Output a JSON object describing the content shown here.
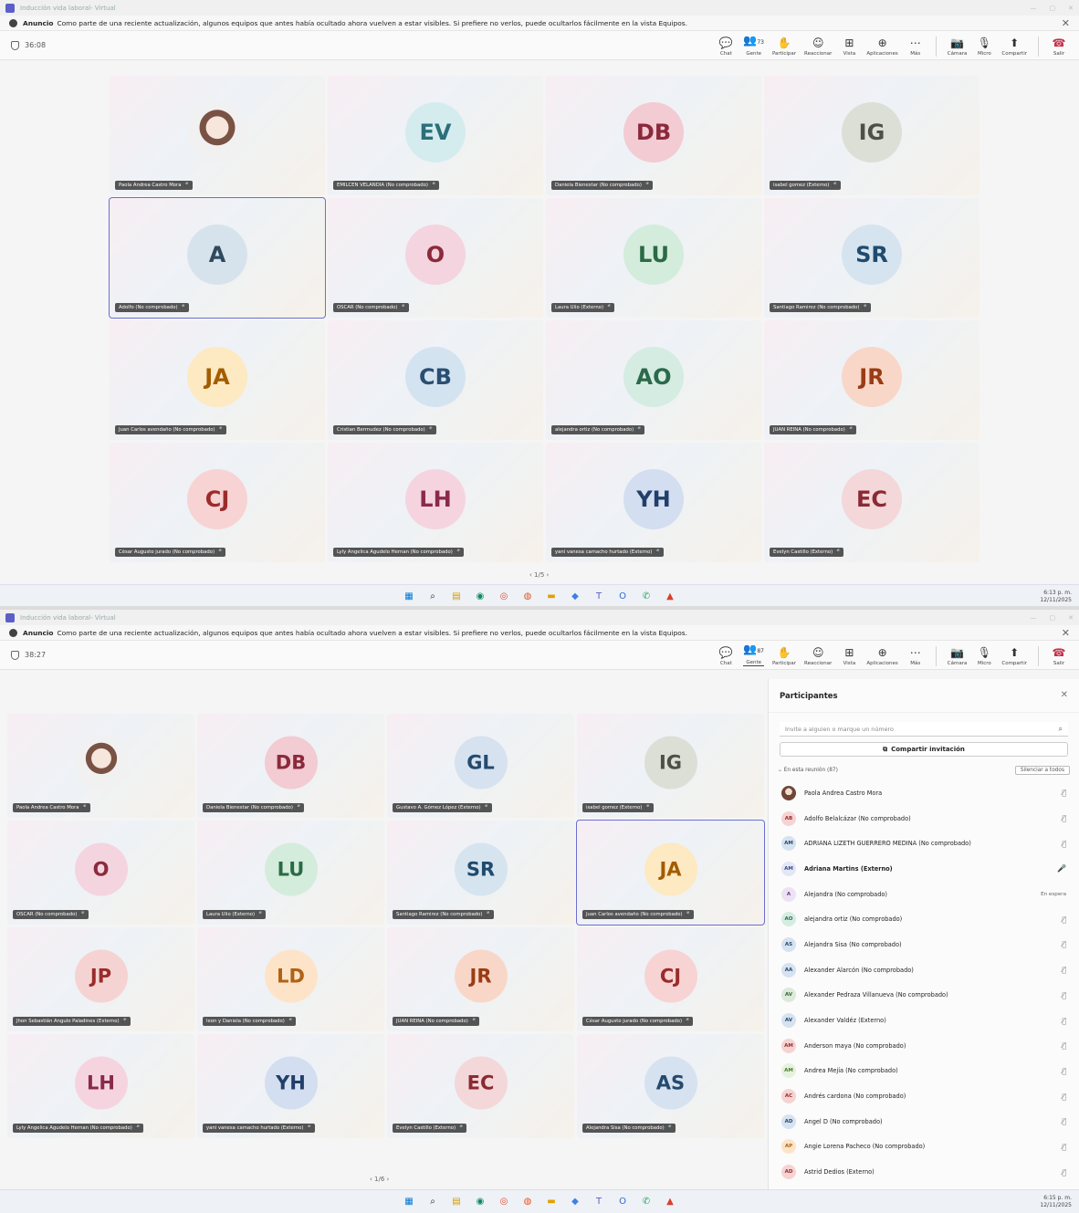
{
  "app": {
    "title": "Inducción vida laboral- Virtual"
  },
  "banner": {
    "label": "Anuncio",
    "text": "Como parte de una reciente actualización, algunos equipos que antes había ocultado ahora vuelven a estar visibles. Si prefiere no verlos, puede ocultarlos fácilmente en la vista Equipos."
  },
  "toolbar": {
    "chat": "Chat",
    "people": "Gente",
    "raise": "Participar",
    "react": "Reaccionar",
    "view": "Vista",
    "apps": "Aplicaciones",
    "more": "Más",
    "camera": "Cámara",
    "mic": "Micro",
    "share": "Compartir",
    "leave": "Salir"
  },
  "screen1": {
    "timer": "36:08",
    "people_count": "73",
    "pager": "1/5",
    "tiles": [
      {
        "initials": "",
        "name": "Paola Andrea Castro Mora",
        "photo": true,
        "color": "#d8d4e0"
      },
      {
        "initials": "EV",
        "name": "EMILCEN VELANDIA (No comprobado)",
        "color": "#d5ecef",
        "fg": "#2b6f7a"
      },
      {
        "initials": "DB",
        "name": "Daniela Bienestar (No comprobado)",
        "color": "#f2cbd3",
        "fg": "#8b2a3c"
      },
      {
        "initials": "IG",
        "name": "isabel gomez (Externo)",
        "color": "#dcdfd6",
        "fg": "#4b5244"
      },
      {
        "initials": "A",
        "name": "Adolfo (No comprobado)",
        "color": "#d7e3ec",
        "fg": "#2f4a5e"
      },
      {
        "initials": "O",
        "name": "OSCAR (No comprobado)",
        "color": "#f4d4de",
        "fg": "#8b2a3c"
      },
      {
        "initials": "LU",
        "name": "Laura Ulio (Externo)",
        "color": "#d4ecdc",
        "fg": "#2b6a45"
      },
      {
        "initials": "SR",
        "name": "Santiago Ramirez (No comprobado)",
        "color": "#d6e4ef",
        "fg": "#1f4b6e"
      },
      {
        "initials": "JA",
        "name": "Juan Carlos avendaño (No comprobado)",
        "color": "#fde9c2",
        "fg": "#a35c00"
      },
      {
        "initials": "CB",
        "name": "Cristian Bermudez (No comprobado)",
        "color": "#d4e3f0",
        "fg": "#2a4f74"
      },
      {
        "initials": "AO",
        "name": "alejandra ortiz (No comprobado)",
        "color": "#d5ece2",
        "fg": "#2b6a4a"
      },
      {
        "initials": "JR",
        "name": "JUAN REINA (No comprobado)",
        "color": "#f9d7c8",
        "fg": "#9a3c14"
      },
      {
        "initials": "CJ",
        "name": "César Augusto jurado (No comprobado)",
        "color": "#f8d3d3",
        "fg": "#9b2c2c"
      },
      {
        "initials": "LH",
        "name": "Lyly Angelica Agudelo Hernan (No comprobado)",
        "color": "#f5d4e0",
        "fg": "#8a2a4a"
      },
      {
        "initials": "YH",
        "name": "yani vanesa camacho hurtado (Externo)",
        "color": "#d3def0",
        "fg": "#223f6a"
      },
      {
        "initials": "EC",
        "name": "Evelyn Castillo (Externo)",
        "color": "#f4d7d9",
        "fg": "#8b2a34"
      }
    ]
  },
  "screen2": {
    "timer": "38:27",
    "people_count": "87",
    "pager": "1/6",
    "tiles": [
      {
        "initials": "",
        "name": "Paola Andrea Castro Mora",
        "photo": true,
        "color": "#d8d4e0"
      },
      {
        "initials": "DB",
        "name": "Daniela Bienestar (No comprobado)",
        "color": "#f2cbd3",
        "fg": "#8b2a3c"
      },
      {
        "initials": "GL",
        "name": "Gustavo A. Gómez López (Externo)",
        "color": "#d6e2ef",
        "fg": "#244a6e"
      },
      {
        "initials": "IG",
        "name": "isabel gomez (Externo)",
        "color": "#dcdfd6",
        "fg": "#4b5244"
      },
      {
        "initials": "O",
        "name": "OSCAR (No comprobado)",
        "color": "#f4d4de",
        "fg": "#8b2a3c"
      },
      {
        "initials": "LU",
        "name": "Laura Ulio (Externo)",
        "color": "#d4ecdc",
        "fg": "#2b6a45"
      },
      {
        "initials": "SR",
        "name": "Santiago Ramirez (No comprobado)",
        "color": "#d6e4ef",
        "fg": "#1f4b6e"
      },
      {
        "initials": "JA",
        "name": "Juan Carlos avendaño (No comprobado)",
        "color": "#fde9c2",
        "fg": "#a35c00"
      },
      {
        "initials": "JP",
        "name": "Jhon Sebastián Angulo Paladines (Externo)",
        "color": "#f6d3d3",
        "fg": "#9b2c2c"
      },
      {
        "initials": "LD",
        "name": "leon y Daniela (No comprobado)",
        "color": "#fde4c8",
        "fg": "#b06216"
      },
      {
        "initials": "JR",
        "name": "JUAN REINA (No comprobado)",
        "color": "#f9d7c8",
        "fg": "#9a3c14"
      },
      {
        "initials": "CJ",
        "name": "César Augusto jurado (No comprobado)",
        "color": "#f8d3d3",
        "fg": "#9b2c2c"
      },
      {
        "initials": "LH",
        "name": "Lyly Angelica Agudelo Hernan (No comprobado)",
        "color": "#f5d4e0",
        "fg": "#8a2a4a"
      },
      {
        "initials": "YH",
        "name": "yani vanesa camacho hurtado (Externo)",
        "color": "#d3def0",
        "fg": "#223f6a"
      },
      {
        "initials": "EC",
        "name": "Evelyn Castillo (Externo)",
        "color": "#f4d7d9",
        "fg": "#8b2a34"
      },
      {
        "initials": "AS",
        "name": "Alejandra Sisa (No comprobado)",
        "color": "#d6e2ef",
        "fg": "#244a6e"
      }
    ]
  },
  "panel": {
    "title": "Participantes",
    "search_placeholder": "Invite a alguien o marque un número",
    "share_invite": "Compartir invitación",
    "in_meeting": "En esta reunión (87)",
    "mute_all": "Silenciar a todos",
    "participants": [
      {
        "initials": "",
        "name": "Paola Andrea Castro Mora",
        "photo": true,
        "color": "#c9b3a6",
        "fg": "#5a3b2f",
        "status": "mic-off"
      },
      {
        "initials": "AB",
        "name": "Adolfo Belalcázar (No comprobado)",
        "color": "#f6d3d3",
        "fg": "#9b2c2c",
        "status": "mic-off"
      },
      {
        "initials": "AM",
        "name": "ADRIANA LIZETH GUERRERO MEDINA (No comprobado)",
        "color": "#d6e2ef",
        "fg": "#244a6e",
        "status": "mic-off"
      },
      {
        "initials": "AM",
        "name": "Adriana Martins (Externo)",
        "color": "#e3e6f5",
        "fg": "#3a4a8a",
        "status": "mic-on",
        "bold": true
      },
      {
        "initials": "A",
        "name": "Alejandra (No comprobado)",
        "color": "#ece2f4",
        "fg": "#6a3f8a",
        "status": "waiting",
        "status_text": "En espera"
      },
      {
        "initials": "AO",
        "name": "alejandra ortiz (No comprobado)",
        "color": "#d5ece2",
        "fg": "#2b6a4a",
        "status": "mic-off"
      },
      {
        "initials": "AS",
        "name": "Alejandra Sisa (No comprobado)",
        "color": "#d6e2ef",
        "fg": "#244a6e",
        "status": "mic-off"
      },
      {
        "initials": "AA",
        "name": "Alexander Alarcón (No comprobado)",
        "color": "#d6e2ef",
        "fg": "#244a6e",
        "status": "mic-off"
      },
      {
        "initials": "AV",
        "name": "Alexander Pedraza Villanueva (No comprobado)",
        "color": "#dceadb",
        "fg": "#3d6a38",
        "status": "mic-off"
      },
      {
        "initials": "AV",
        "name": "Alexander Valdéz (Externo)",
        "color": "#d6e2ef",
        "fg": "#244a6e",
        "status": "mic-off"
      },
      {
        "initials": "AM",
        "name": "Anderson maya (No comprobado)",
        "color": "#f6d3d3",
        "fg": "#9b2c2c",
        "status": "mic-off"
      },
      {
        "initials": "AM",
        "name": "Andrea Mejía (No comprobado)",
        "color": "#e6f2dc",
        "fg": "#4b7a2e",
        "status": "mic-off"
      },
      {
        "initials": "AC",
        "name": "Andrés cardona (No comprobado)",
        "color": "#f6d3d3",
        "fg": "#9b2c2c",
        "status": "mic-off"
      },
      {
        "initials": "AD",
        "name": "Angel D (No comprobado)",
        "color": "#d6e2ef",
        "fg": "#244a6e",
        "status": "mic-off"
      },
      {
        "initials": "AP",
        "name": "Angie Lorena Pacheco (No comprobado)",
        "color": "#fde4c8",
        "fg": "#b06216",
        "status": "mic-off"
      },
      {
        "initials": "AD",
        "name": "Astrid Dedios (Externo)",
        "color": "#f6d3d3",
        "fg": "#9b2c2c",
        "status": "mic-off"
      }
    ]
  },
  "taskbar": {
    "screen1_time": "6:13 p. m.",
    "screen1_date": "12/11/2025",
    "screen2_time": "6:15 p. m.",
    "screen2_date": "12/11/2025"
  }
}
